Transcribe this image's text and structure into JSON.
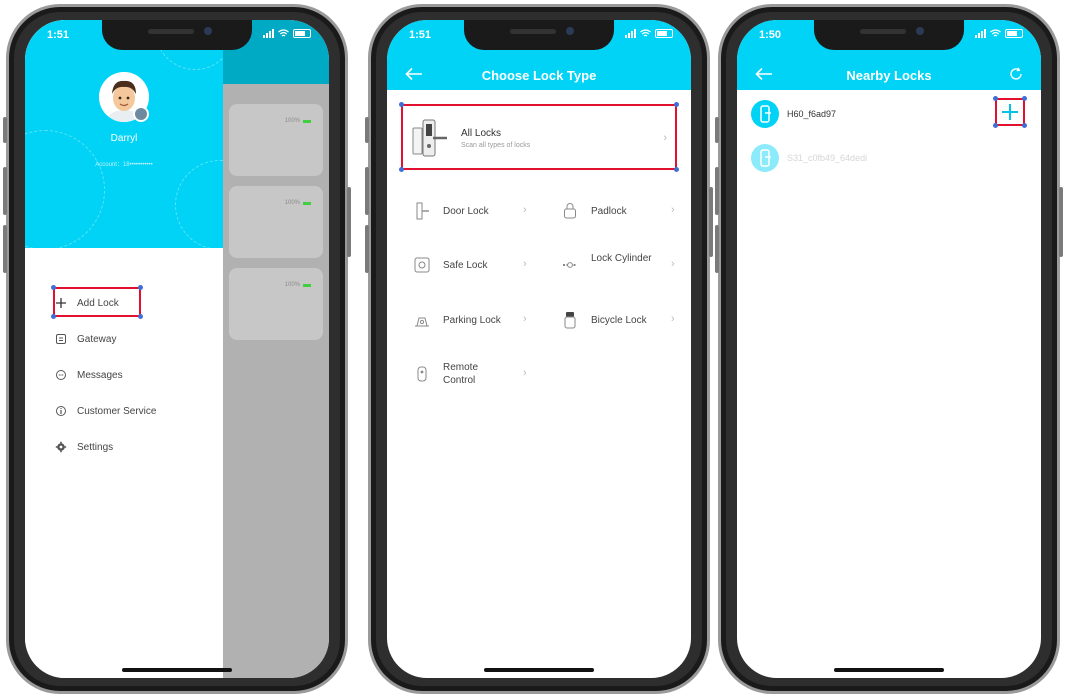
{
  "phone1": {
    "status_time": "1:51",
    "user_name": "Darryl",
    "account_label": "Account：18•••••••••••",
    "menu": [
      {
        "label": "Add Lock",
        "icon": "plus-icon"
      },
      {
        "label": "Gateway",
        "icon": "gateway-icon"
      },
      {
        "label": "Messages",
        "icon": "message-icon"
      },
      {
        "label": "Customer Service",
        "icon": "info-icon"
      },
      {
        "label": "Settings",
        "icon": "gear-icon"
      }
    ],
    "lock_cards": [
      {
        "battery": "100%"
      },
      {
        "battery": "100%"
      },
      {
        "battery": "100%"
      }
    ]
  },
  "phone2": {
    "status_time": "1:51",
    "title": "Choose Lock Type",
    "all_locks": {
      "title": "All Locks",
      "subtitle": "Scan all types of locks"
    },
    "types": [
      {
        "label": "Door Lock",
        "icon": "door-lock-icon"
      },
      {
        "label": "Padlock",
        "icon": "padlock-icon"
      },
      {
        "label": "Safe Lock",
        "icon": "safe-icon"
      },
      {
        "label": "Lock Cylinder",
        "icon": "cylinder-icon"
      },
      {
        "label": "Parking Lock",
        "icon": "parking-lock-icon"
      },
      {
        "label": "Bicycle Lock",
        "icon": "bicycle-lock-icon"
      },
      {
        "label": "Remote Control",
        "icon": "remote-icon"
      }
    ]
  },
  "phone3": {
    "status_time": "1:50",
    "title": "Nearby Locks",
    "locks": [
      {
        "name": "H60_f6ad97",
        "active": true
      },
      {
        "name": "S31_c0fb49_64dedi",
        "active": false
      }
    ]
  },
  "colors": {
    "accent": "#00d3f5",
    "highlight": "#e0102e",
    "overlay": "#b1b1b1"
  }
}
